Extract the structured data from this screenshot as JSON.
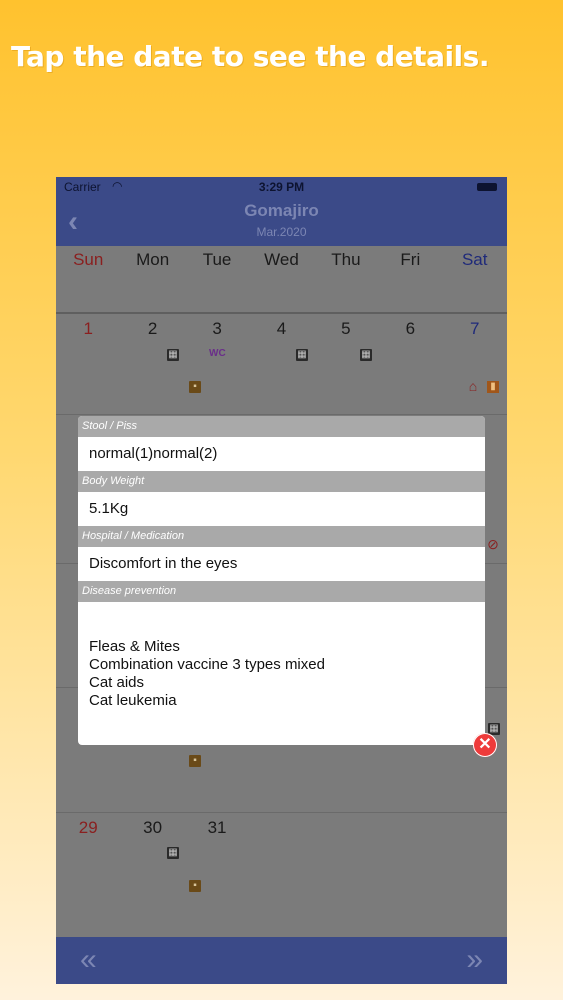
{
  "headline": "Tap the date to see the details.",
  "status": {
    "carrier": "Carrier",
    "time": "3:29 PM"
  },
  "nav": {
    "title": "Gomajiro",
    "subtitle": "Mar.2020",
    "back_icon": "chevron-left-icon"
  },
  "weekdays": [
    "Sun",
    "Mon",
    "Tue",
    "Wed",
    "Thu",
    "Fri",
    "Sat"
  ],
  "week1": [
    "1",
    "2",
    "3",
    "4",
    "5",
    "6",
    "7"
  ],
  "week_last": [
    "29",
    "30",
    "31"
  ],
  "icons": {
    "wc": "WC"
  },
  "popup": {
    "stool_label": "Stool / Piss",
    "stool_value": "normal(1)normal(2)",
    "weight_label": "Body Weight",
    "weight_value": "5.1Kg",
    "hospital_label": "Hospital / Medication",
    "hospital_value": "Discomfort in the eyes",
    "prevention_label": "Disease prevention",
    "prevention_items": [
      "Fleas & Mites",
      "Combination vaccine 3 types mixed",
      "Cat aids",
      "Cat leukemia"
    ]
  },
  "footer": {
    "prev": "«",
    "next": "»"
  },
  "colors": {
    "navbar": "#3b4a88",
    "accent_sun": "#8a1f1f",
    "accent_sat": "#1f2a7a",
    "close": "#ee3b3b"
  }
}
